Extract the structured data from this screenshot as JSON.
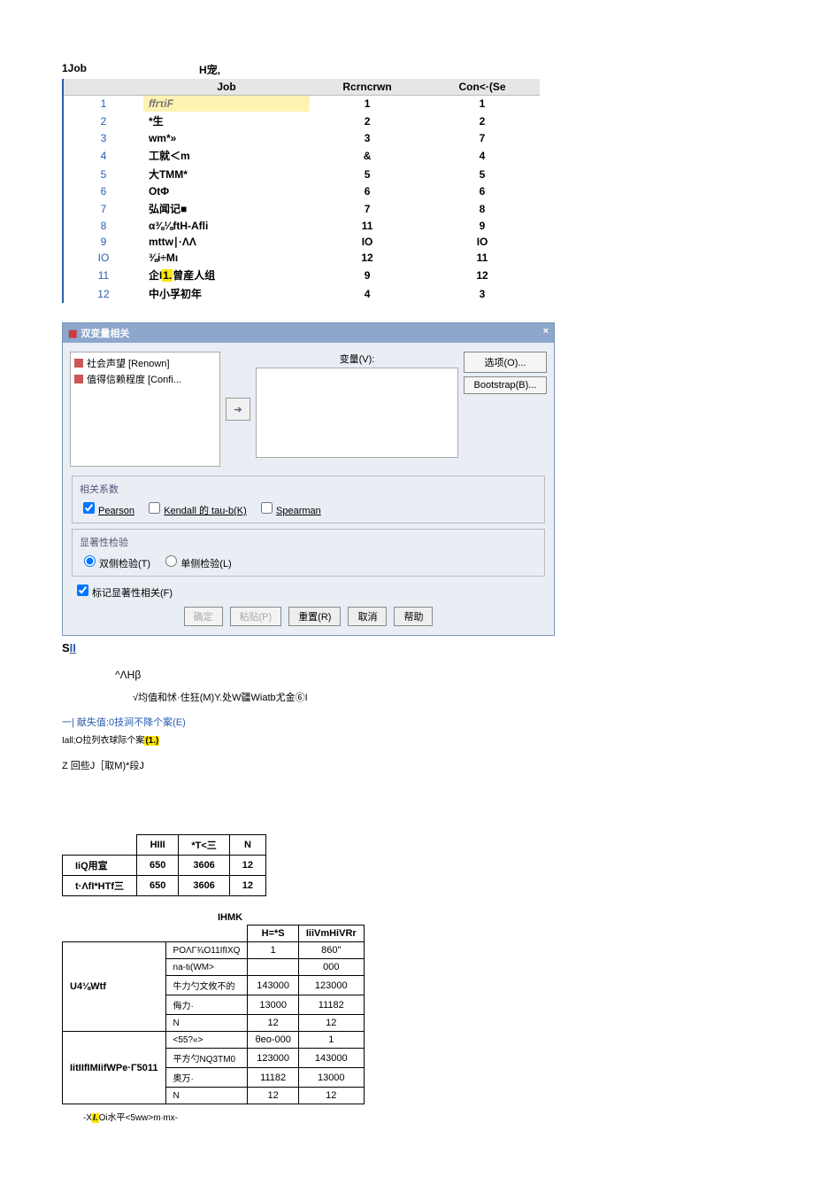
{
  "top_title": {
    "left": "1Job",
    "right": "H宠,"
  },
  "table1": {
    "headers": [
      "",
      "Job",
      "Rcrncrwn",
      "Con<·(Se"
    ],
    "rows": [
      {
        "n": "1",
        "job": "ffrτiF",
        "c1": "1",
        "c2": "1",
        "hi": true
      },
      {
        "n": "2",
        "job": "*生",
        "c1": "2",
        "c2": "2"
      },
      {
        "n": "3",
        "job": "wm*»",
        "c1": "3",
        "c2": "7"
      },
      {
        "n": "4",
        "job": "工就＜m",
        "c1": "&",
        "c2": "4"
      },
      {
        "n": "5",
        "job": "大TMM*",
        "c1": "5",
        "c2": "5"
      },
      {
        "n": "6",
        "job": "OtΦ",
        "c1": "6",
        "c2": "6"
      },
      {
        "n": "7",
        "job": "弘闻记■",
        "c1": "7",
        "c2": "8"
      },
      {
        "n": "8",
        "job": "α⅜⅛ftH-Afli",
        "c1": "11",
        "c2": "9"
      },
      {
        "n": "9",
        "job": "mttw∣·ΛΛ",
        "c1": "IO",
        "c2": "IO"
      },
      {
        "n": "IO",
        "job": "⅜i÷Mι",
        "c1": "12",
        "c2": "11"
      },
      {
        "n": "11",
        "job": "企I1.曾産人组",
        "c1": "9",
        "c2": "12",
        "y": true
      },
      {
        "n": "12",
        "job": "中小孚初年",
        "c1": "4",
        "c2": "3"
      }
    ]
  },
  "dialog": {
    "title": "双变量相关",
    "close": "×",
    "list": [
      "社会声望 [Renown]",
      "值得信赖程度 [Confi..."
    ],
    "var_label": "变量(V):",
    "right_buttons": [
      "选项(O)...",
      "Bootstrap(B)..."
    ],
    "coef": {
      "legend": "相关系数",
      "pearson": "Pearson",
      "kendall": "Kendall 的 tau-b(K)",
      "spearman": "Spearman"
    },
    "sig": {
      "legend": "显著性检验",
      "two": "双侧检验(T)",
      "one": "单侧检验(L)"
    },
    "flag": "标记显著性相关(F)",
    "buttons": {
      "ok": "确定",
      "paste": "粘贴(P)",
      "reset": "重置(R)",
      "cancel": "取消",
      "help": "帮助"
    }
  },
  "below_s": {
    "s": "S",
    "ii": "II"
  },
  "para1": "^ΛHβ",
  "para2": "√均值和怵·住狂(M)Y.处W疆Wiatb尤金⑥I",
  "para_blue": "一| 献失值:0技涧不降个案(E)",
  "para_sm_pre": "Iall;O拉列衣球际个案",
  "para_sm_y": "(1.)",
  "para_z": "Z        回些J［取M)*段J",
  "table2": {
    "headers": [
      "",
      "HIII",
      "*T<三",
      "N"
    ],
    "rows": [
      {
        "lbl": "IiQ用宣",
        "a": "650",
        "b": "3606",
        "c": "12"
      },
      {
        "lbl": "t·ΛfI*HTf三",
        "a": "650",
        "b": "3606",
        "c": "12"
      }
    ]
  },
  "ihmk": "IHMK",
  "table3": {
    "head2": [
      "H=*S",
      "IiiVmHiVRr"
    ],
    "group1": {
      "name": "U4⅛Wtf",
      "rows": [
        {
          "lbl": "POΛΓ¾O11IfIXQ",
          "a": "1",
          "b": "860\""
        },
        {
          "lbl": "na-tι(WM>",
          "a": "",
          "b": "000"
        },
        {
          "lbl": "牛力勺文攸不的",
          "a": "143000",
          "b": "123000"
        },
        {
          "lbl": "侮力·",
          "a": "13000",
          "b": "11182"
        },
        {
          "lbl": "N",
          "a": "12",
          "b": "12"
        }
      ]
    },
    "group2": {
      "name": "IitIIfIMIifWPe·Γ5011",
      "rows": [
        {
          "lbl": "<55?«>",
          "a": "θeo-000",
          "b": "1"
        },
        {
          "lbl": "平方勺NQ3TM0",
          "a": "123000",
          "b": "143000"
        },
        {
          "lbl": "奥万·",
          "a": "11182",
          "b": "13000"
        },
        {
          "lbl": "N",
          "a": "12",
          "b": "12"
        }
      ]
    }
  },
  "footnote": {
    "pre": "-X",
    "y": "I.",
    "post": "Oi水平<5ww>m∙mx-"
  }
}
